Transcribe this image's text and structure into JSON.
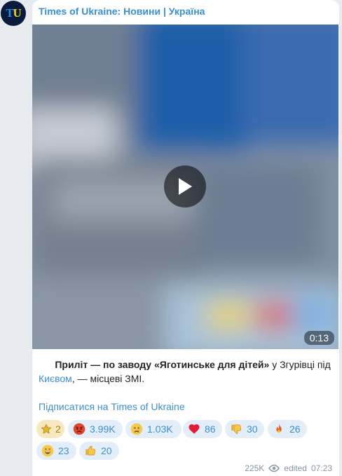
{
  "channel": {
    "avatar_letters": [
      "T",
      "U"
    ],
    "name": "Times of Ukraine: Новини | Україна"
  },
  "video": {
    "duration": "0:13"
  },
  "caption": {
    "lead": "Приліт — по заводу «Яготинське для дітей»",
    "part2": " у Згурівці під ",
    "link": "Києвом",
    "part3": ", — місцеві ЗМІ."
  },
  "subscribe_label": "Підписатися на Times of Ukraine",
  "reactions": [
    {
      "icon": "star-icon",
      "count": "2"
    },
    {
      "icon": "angry-face-icon",
      "count": "3.99K"
    },
    {
      "icon": "crying-face-icon",
      "count": "1.03K"
    },
    {
      "icon": "heart-icon",
      "count": "86"
    },
    {
      "icon": "thumbs-down-icon",
      "count": "30"
    },
    {
      "icon": "fire-icon",
      "count": "26"
    },
    {
      "icon": "grinning-face-icon",
      "count": "23"
    },
    {
      "icon": "thumbs-up-icon",
      "count": "20"
    }
  ],
  "footer": {
    "views": "225K",
    "edited_label": "edited",
    "time": "07:23"
  },
  "colors": {
    "accent": "#3a8fd3",
    "background": "#e7ebf0",
    "reaction_bg": "#e4eef8"
  }
}
